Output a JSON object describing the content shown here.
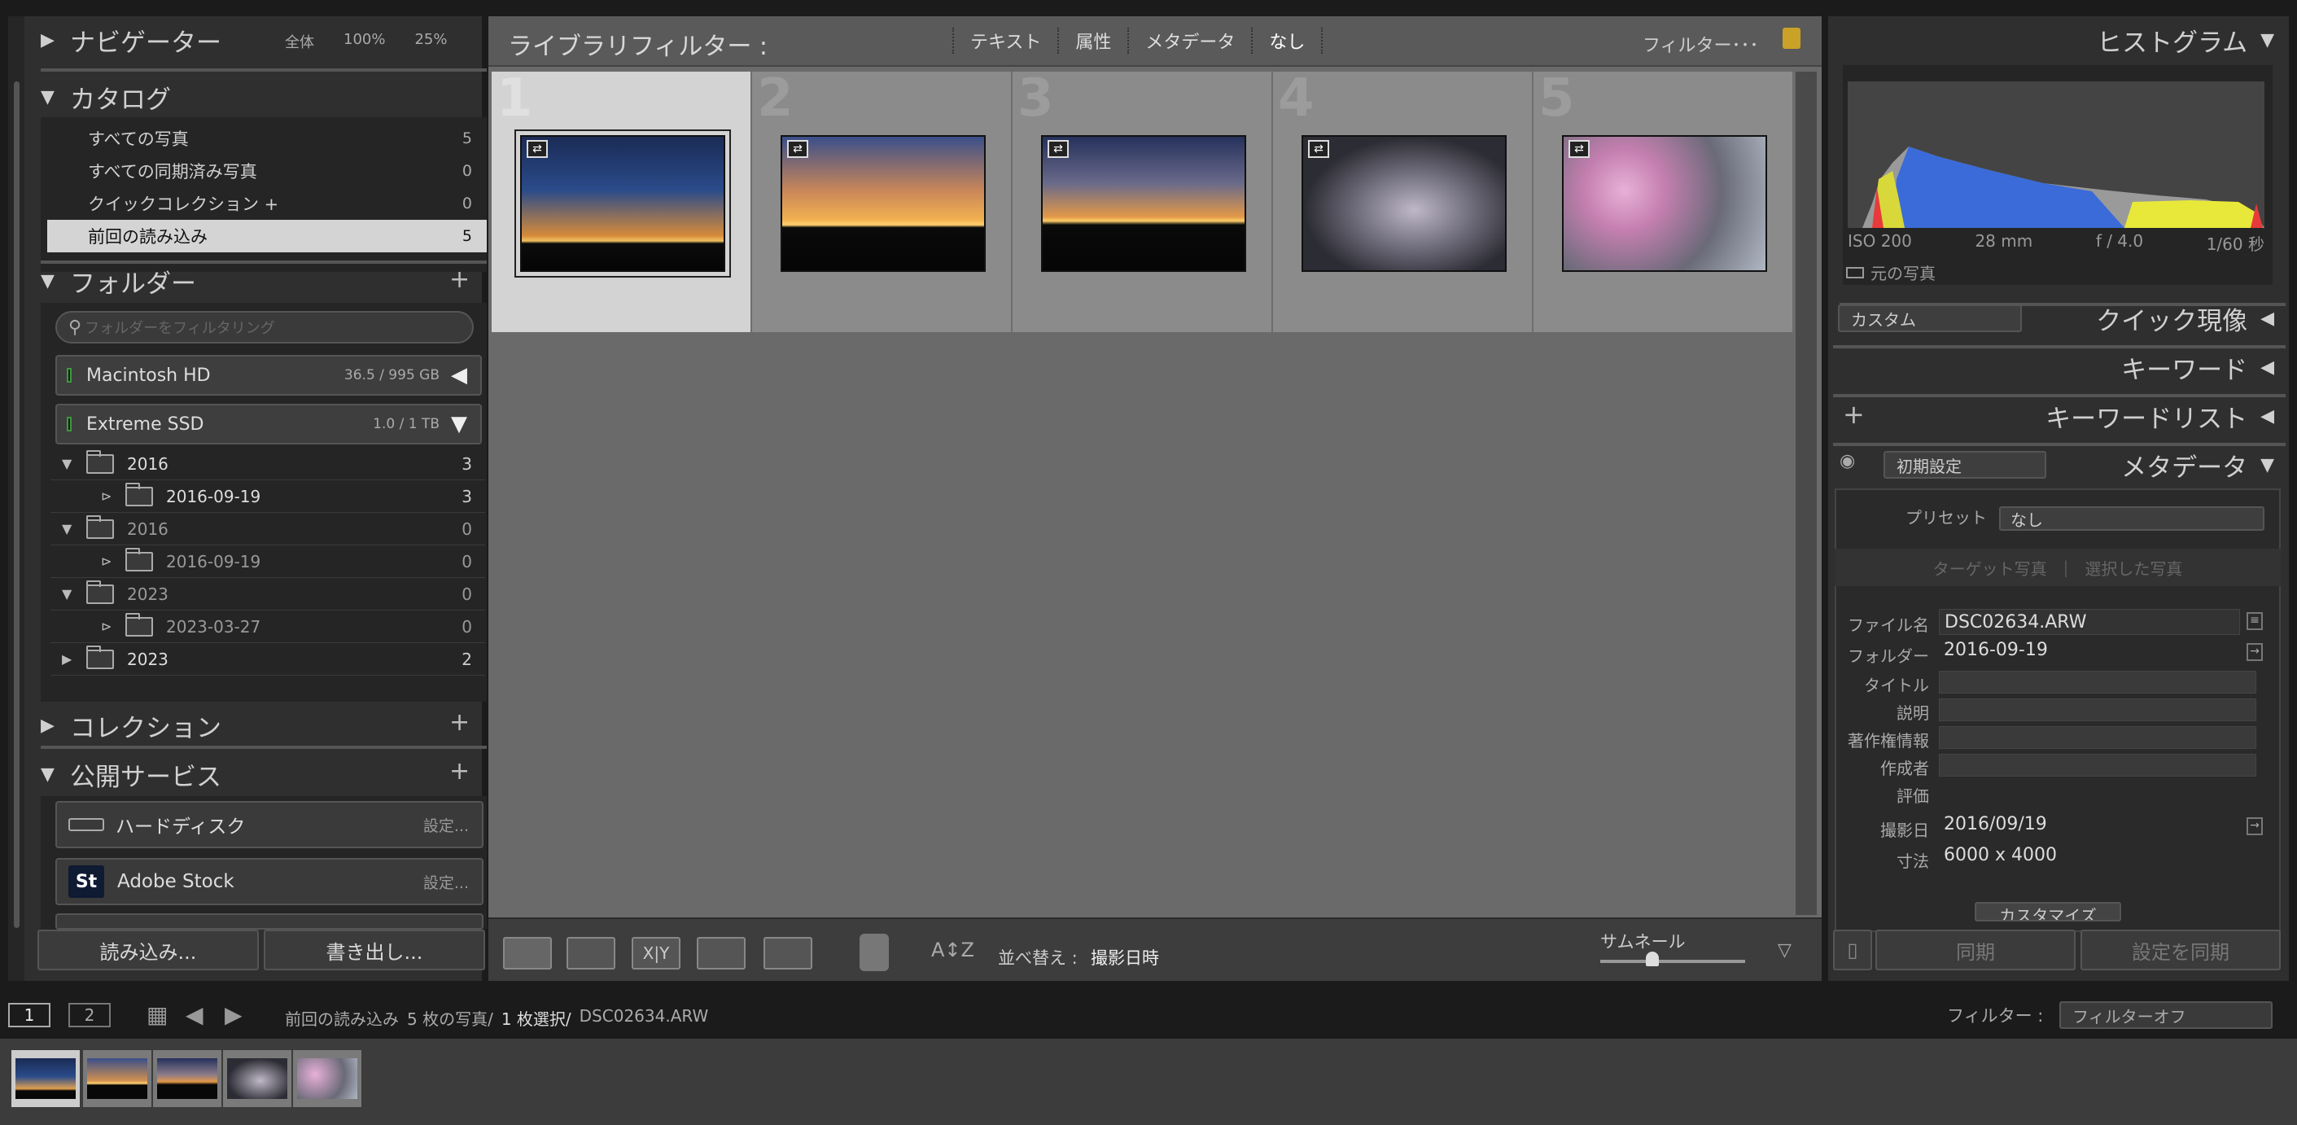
{
  "navigator": {
    "title": "ナビゲーター",
    "opt_all": "全体",
    "opt_100": "100%",
    "opt_25": "25%"
  },
  "catalog": {
    "title": "カタログ",
    "items": [
      {
        "label": "すべての写真",
        "count": "5"
      },
      {
        "label": "すべての同期済み写真",
        "count": "0"
      },
      {
        "label": "クイックコレクション +",
        "count": "0"
      },
      {
        "label": "前回の読み込み",
        "count": "5"
      }
    ]
  },
  "folders": {
    "title": "フォルダー",
    "search_placeholder": "フォルダーをフィルタリング",
    "volumes": [
      {
        "name": "Macintosh HD",
        "size": "36.5 / 995 GB"
      },
      {
        "name": "Extreme SSD",
        "size": "1.0 / 1 TB"
      }
    ],
    "tree": [
      {
        "name": "2016",
        "count": "3"
      },
      {
        "name": "2016-09-19",
        "count": "3"
      },
      {
        "name": "2016",
        "count": "0"
      },
      {
        "name": "2016-09-19",
        "count": "0"
      },
      {
        "name": "2023",
        "count": "0"
      },
      {
        "name": "2023-03-27",
        "count": "0"
      },
      {
        "name": "2023",
        "count": "2"
      }
    ]
  },
  "collections": {
    "title": "コレクション"
  },
  "publish": {
    "title": "公開サービス",
    "services": [
      {
        "name": "ハードディスク",
        "action": "設定..."
      },
      {
        "name": "Adobe Stock",
        "action": "設定..."
      }
    ],
    "adobe_stock_icon": "St"
  },
  "left_buttons": {
    "import": "読み込み...",
    "export": "書き出し..."
  },
  "filter_bar": {
    "title": "ライブラリフィルター :",
    "tabs": [
      "テキスト",
      "属性",
      "メタデータ",
      "なし"
    ],
    "preset": "フィルター･･･"
  },
  "grid": {
    "cells": [
      {
        "num": "1"
      },
      {
        "num": "2"
      },
      {
        "num": "3"
      },
      {
        "num": "4"
      },
      {
        "num": "5"
      }
    ]
  },
  "toolbar": {
    "sort_label": "並べ替え :",
    "sort_value": "撮影日時",
    "thumb_label": "サムネール",
    "thumb_level": 0.35
  },
  "histogram": {
    "title": "ヒストグラム",
    "iso": "ISO 200",
    "focal": "28 mm",
    "aperture": "f / 4.0",
    "shutter": "1/60 秒",
    "original": "元の写真"
  },
  "quick_develop": {
    "preset": "カスタム",
    "title": "クイック現像"
  },
  "keyword": {
    "title": "キーワード"
  },
  "keyword_list": {
    "title": "キーワードリスト"
  },
  "metadata": {
    "preset": "初期設定",
    "title": "メタデータ",
    "preset_label": "プリセット",
    "preset_value": "なし",
    "target": "ターゲット写真",
    "selected": "選択した写真",
    "rows": [
      {
        "label": "ファイル名",
        "value": "DSC02634.ARW"
      },
      {
        "label": "フォルダー",
        "value": "2016-09-19"
      },
      {
        "label": "タイトル",
        "value": ""
      },
      {
        "label": "説明",
        "value": ""
      },
      {
        "label": "著作権情報",
        "value": ""
      },
      {
        "label": "作成者",
        "value": ""
      },
      {
        "label": "評価",
        "value": ""
      },
      {
        "label": "撮影日",
        "value": "2016/09/19"
      },
      {
        "label": "寸法",
        "value": "6000 x 4000"
      }
    ],
    "customize": "カスタマイズ"
  },
  "right_buttons": {
    "sync": "同期",
    "sync_settings": "設定を同期"
  },
  "status": {
    "page1": "1",
    "page2": "2",
    "source": "前回の読み込み",
    "count": "5 枚の写真/",
    "selected": "1 枚選択/",
    "file": "DSC02634.ARW",
    "filter_label": "フィルター :",
    "filter_value": "フィルターオフ"
  },
  "colors": {
    "accent_sel": "#d4d4d4",
    "panel": "#2f2f2f",
    "center": "#6a6a6a"
  }
}
